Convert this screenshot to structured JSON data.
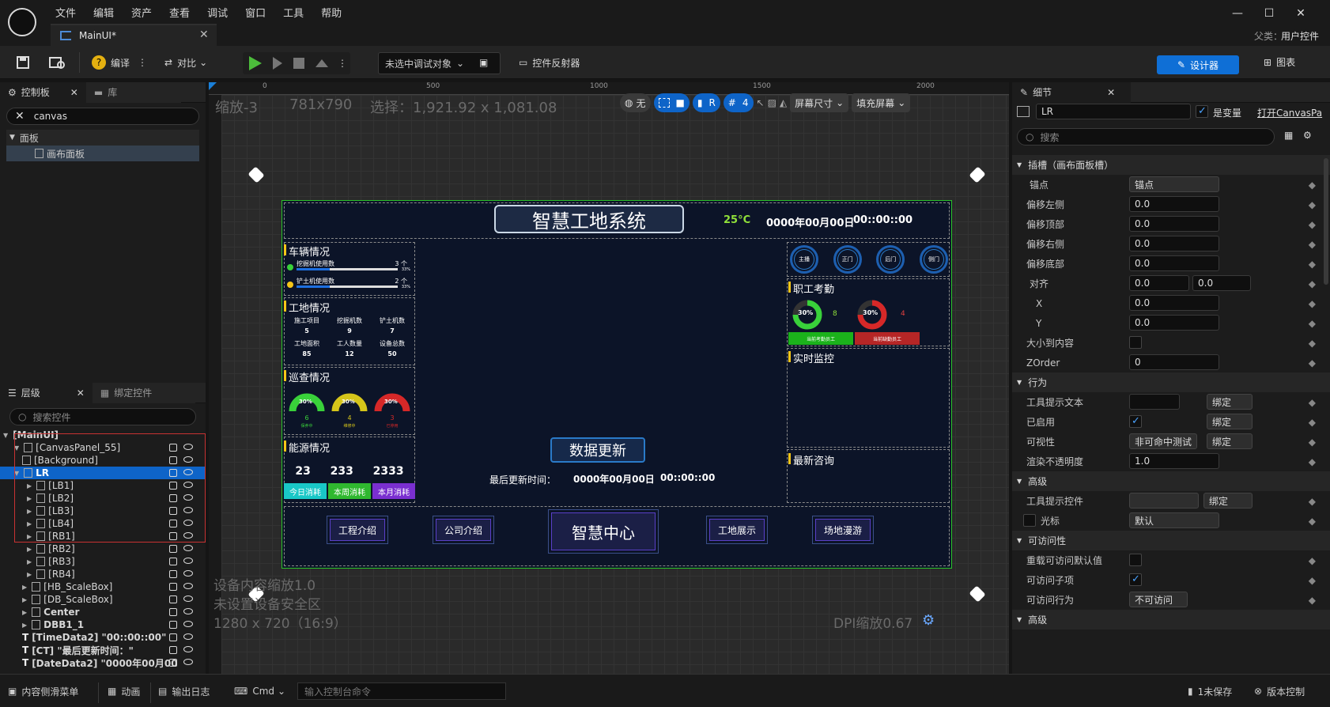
{
  "menu": [
    "文件",
    "编辑",
    "资产",
    "查看",
    "调试",
    "窗口",
    "工具",
    "帮助"
  ],
  "tab": {
    "title": "MainUI*"
  },
  "parent": {
    "label": "父类：",
    "value": "用户控件"
  },
  "toolbar": {
    "compile": "编译",
    "diff": "对比",
    "debug_target": "未选中调试对象",
    "widget_reflector": "控件反射器",
    "designer": "设计器",
    "graph": "图表"
  },
  "palette": {
    "tab": "控制板",
    "tab2": "库",
    "search": "canvas",
    "group": "面板",
    "item": "画布面板"
  },
  "hierarchy": {
    "tab": "层级",
    "tab2": "绑定控件",
    "search_placeholder": "搜索控件",
    "rows": [
      "[MainUI]",
      "[CanvasPanel_55]",
      "[Background]",
      "LR",
      "[LB1]",
      "[LB2]",
      "[LB3]",
      "[LB4]",
      "[RB1]",
      "[RB2]",
      "[RB3]",
      "[RB4]",
      "[HB_ScaleBox]",
      "[DB_ScaleBox]",
      "Center",
      "DBB1_1",
      "[TimeData2] \"00::00::00\"",
      "[CT] \"最后更新时间：\"",
      "[DateData2] \"0000年00月00"
    ]
  },
  "viewport": {
    "zoom": "缩放-3",
    "size": "781x790",
    "selection": "选择：1,921.92 x 1,081.08",
    "ruler": [
      "0",
      "500",
      "1000",
      "1500",
      "2000"
    ],
    "none_label": "无",
    "r_label": "R",
    "grid_num": "4",
    "screen_size": "屏幕尺寸",
    "fill_screen": "填充屏幕",
    "info1": "设备内容缩放1.0",
    "info2": "未设置设备安全区",
    "info3": "1280 x 720（16:9）",
    "dpi": "DPI缩放0.67"
  },
  "canvas": {
    "title": "智慧工地系统",
    "temp": "25°C",
    "date": "0000年00月00日",
    "time": "00::00::00",
    "vehicle": {
      "title": "车辆情况",
      "rows": [
        {
          "label": "挖掘机使用数",
          "count": "3 个",
          "pct": "33%",
          "fill": 0.33
        },
        {
          "label": "铲土机使用数",
          "count": "2 个",
          "pct": "33%",
          "fill": 0.33
        }
      ]
    },
    "site": {
      "title": "工地情况",
      "cells": [
        {
          "label": "施工项目",
          "value": "5"
        },
        {
          "label": "挖掘机数",
          "value": "9"
        },
        {
          "label": "铲土机数",
          "value": "7"
        },
        {
          "label": "工地面积",
          "value": "85"
        },
        {
          "label": "工人数量",
          "value": "12"
        },
        {
          "label": "设备总数",
          "value": "50"
        }
      ]
    },
    "patrol": {
      "title": "巡查情况",
      "gauges": [
        {
          "pct": "30%",
          "value": "6",
          "label": "保养中",
          "color": "#39d13a"
        },
        {
          "pct": "30%",
          "value": "4",
          "label": "维修中",
          "color": "#d6c51a"
        },
        {
          "pct": "30%",
          "value": "3",
          "label": "已停用",
          "color": "#d62828"
        }
      ]
    },
    "energy": {
      "title": "能源情况",
      "values": [
        "23",
        "233",
        "2333"
      ],
      "buttons": [
        "今日消耗",
        "本周消耗",
        "本月消耗"
      ]
    },
    "cameras": [
      "主播",
      "正门",
      "后门",
      "侧门"
    ],
    "attendance": {
      "title": "职工考勤",
      "left": {
        "pct": "30%",
        "value": "8",
        "label": "当前考勤员工"
      },
      "right": {
        "pct": "30%",
        "value": "4",
        "label": "当前缺勤员工"
      }
    },
    "monitor": {
      "title": "实时监控"
    },
    "news": {
      "title": "最新咨询"
    },
    "update": {
      "title": "数据更新",
      "label": "最后更新时间：",
      "date": "0000年00月00日",
      "time": "00::00::00"
    },
    "nav": [
      "工程介绍",
      "公司介绍",
      "智慧中心",
      "工地展示",
      "场地漫游"
    ]
  },
  "details": {
    "tab": "细节",
    "name": "LR",
    "is_variable": "是变量",
    "open_canvas": "打开CanvasPa",
    "search": "搜索",
    "slot": "插槽（画布面板槽）",
    "anchor": "锚点",
    "anchor_value": "锚点",
    "fields": [
      {
        "label": "偏移左侧",
        "value": "0.0"
      },
      {
        "label": "偏移顶部",
        "value": "0.0"
      },
      {
        "label": "偏移右侧",
        "value": "0.0"
      },
      {
        "label": "偏移底部",
        "value": "0.0"
      }
    ],
    "align": "对齐",
    "align_x": "0.0",
    "align_y": "0.0",
    "x": "X",
    "x_value": "0.0",
    "y": "Y",
    "y_value": "0.0",
    "size_to_content": "大小到内容",
    "zorder": "ZOrder",
    "zorder_value": "0",
    "behavior": "行为",
    "tooltip_text": "工具提示文本",
    "bind": "绑定",
    "enabled": "已启用",
    "visibility": "可视性",
    "visibility_value": "非可命中测试",
    "opacity": "渲染不透明度",
    "opacity_value": "1.0",
    "advanced": "高级",
    "tooltip_widget": "工具提示控件",
    "cursor": "光标",
    "cursor_value": "默认",
    "accessibility": "可访问性",
    "override_access": "重载可访问默认值",
    "access_children": "可访问子项",
    "access_behavior": "可访问行为",
    "access_behavior_value": "不可访问",
    "advanced2": "高级"
  },
  "status": {
    "drawer": "内容侧滑菜单",
    "anim": "动画",
    "log": "输出日志",
    "cmd": "Cmd",
    "cmd_placeholder": "输入控制台命令",
    "unsaved": "1未保存",
    "version": "版本控制"
  }
}
